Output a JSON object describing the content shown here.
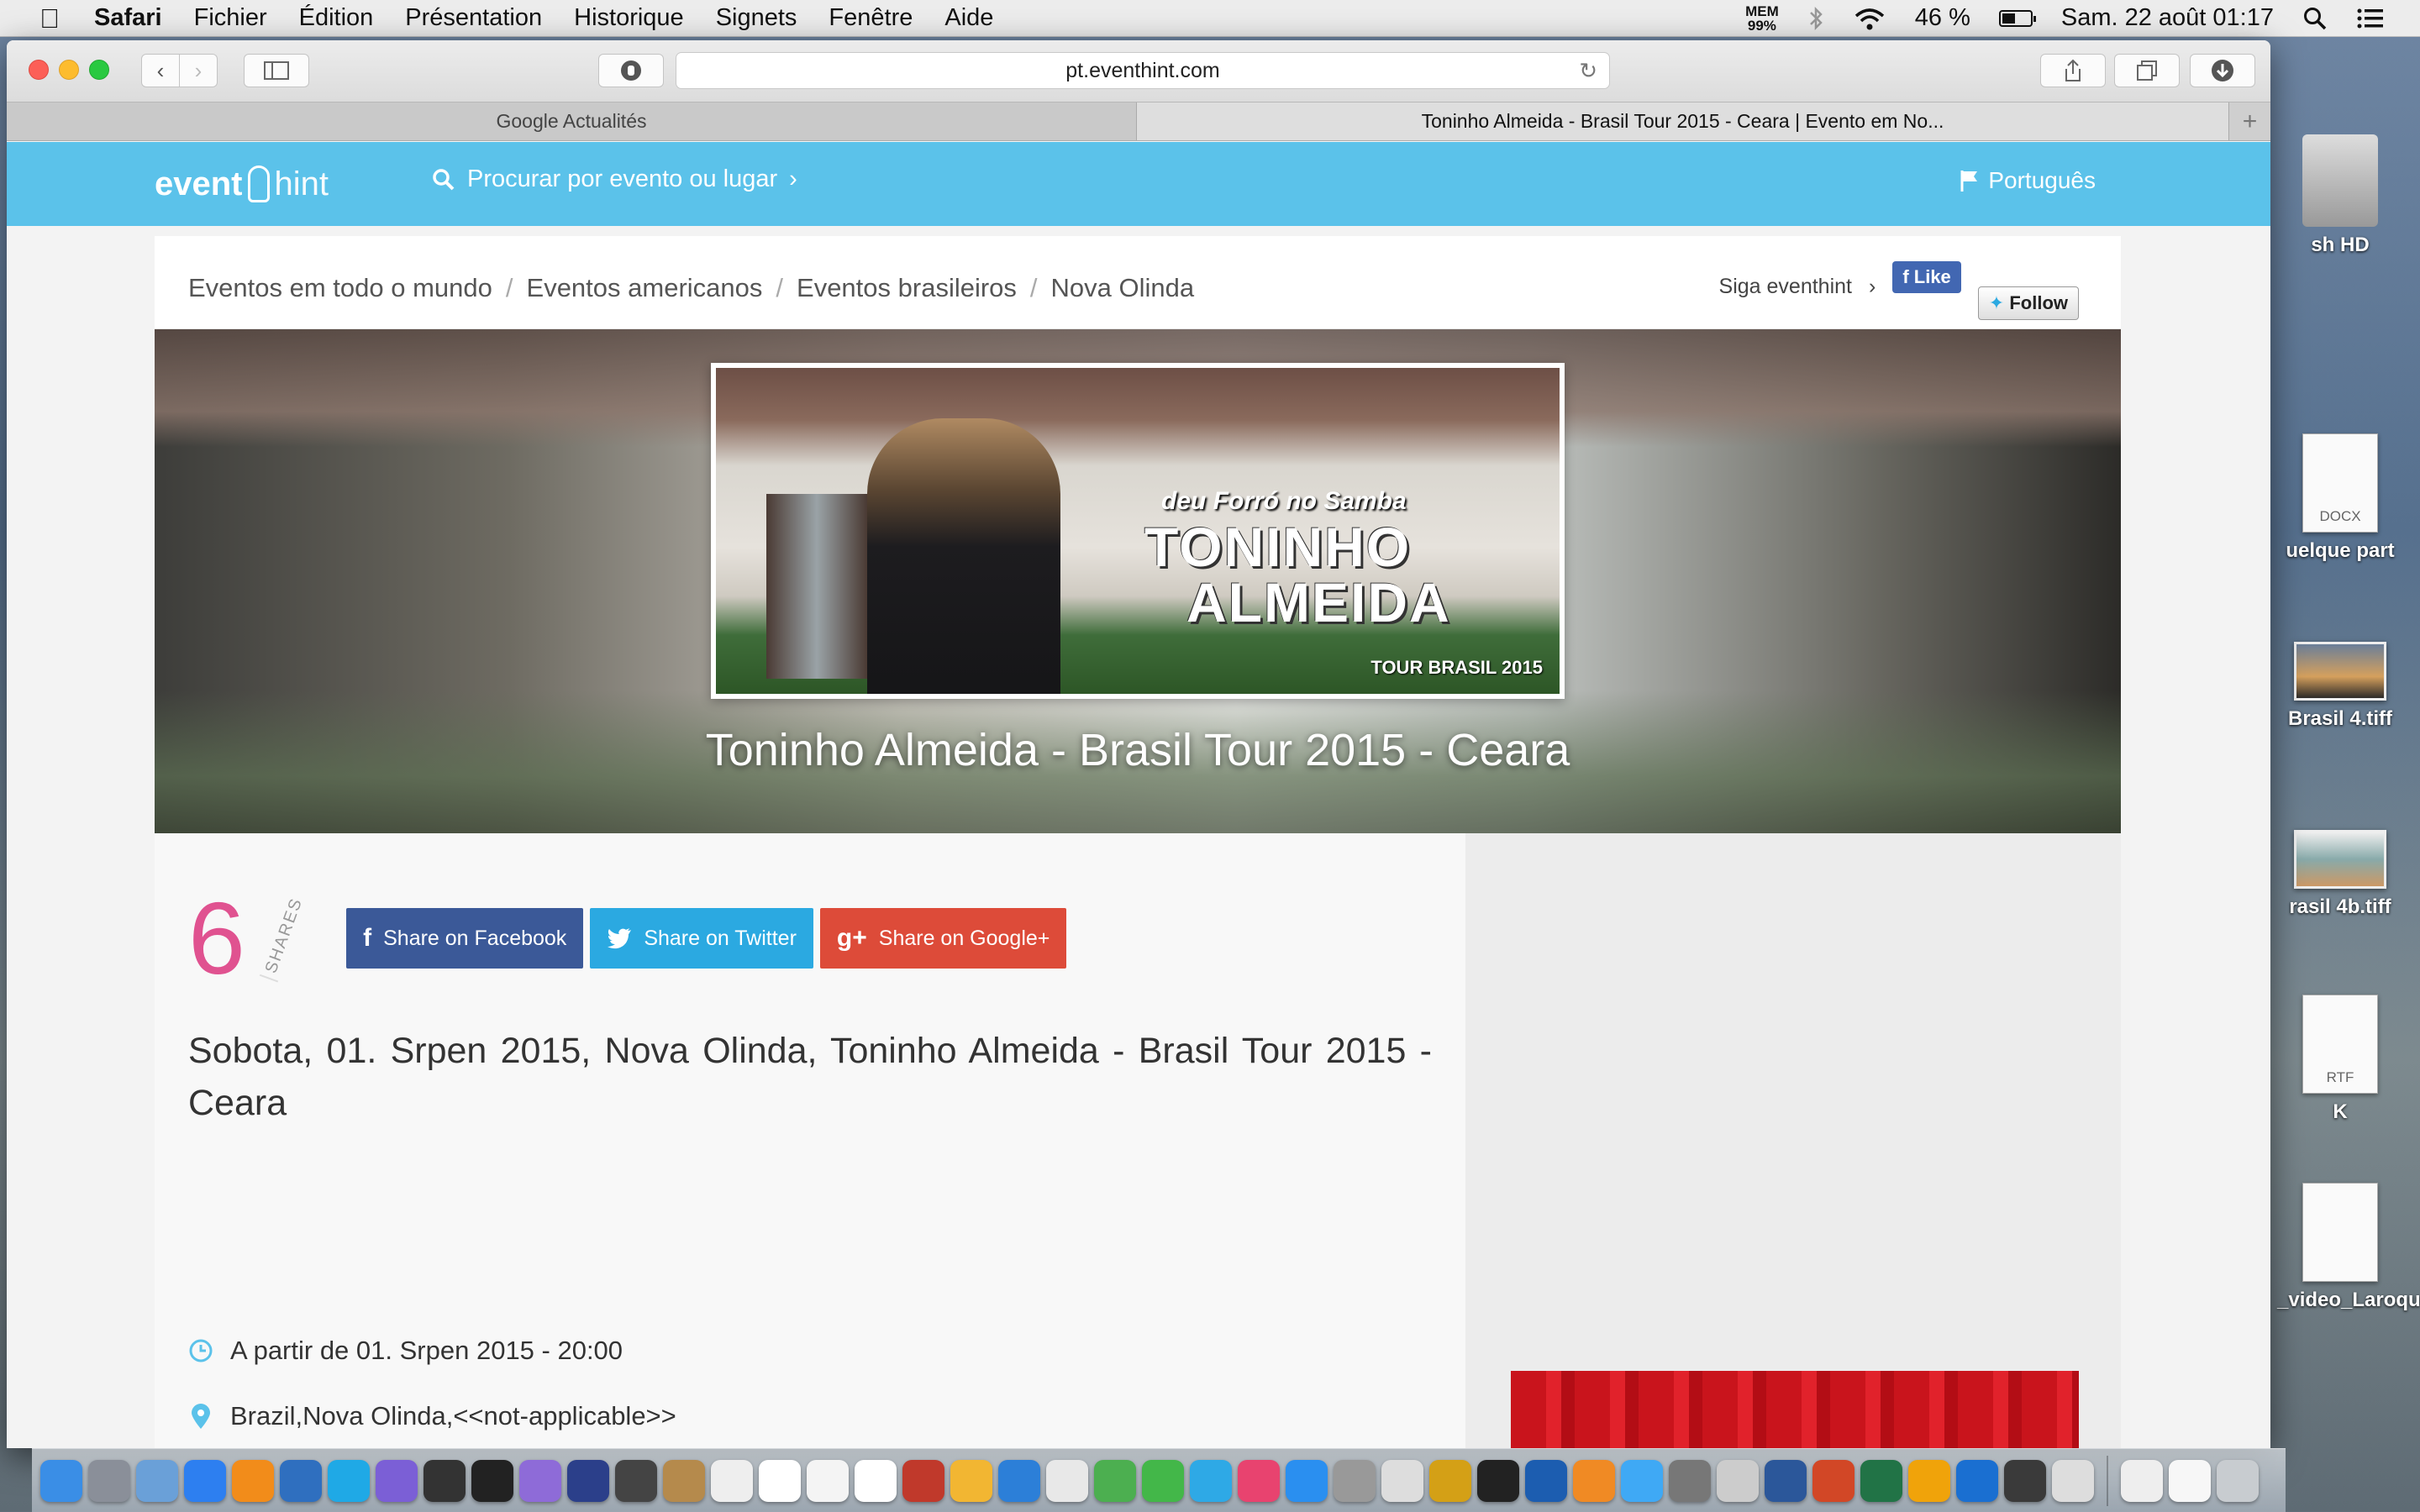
{
  "menubar": {
    "app": "Safari",
    "items": [
      "Fichier",
      "Édition",
      "Présentation",
      "Historique",
      "Signets",
      "Fenêtre",
      "Aide"
    ],
    "mem_label": "MEM",
    "mem_value": "99%",
    "battery": "46 %",
    "battery_level": 0.46,
    "datetime": "Sam. 22 août 01:17"
  },
  "desktop": {
    "items": [
      {
        "label": "sh HD"
      },
      {
        "label": "uelque part",
        "tag": "DOCX"
      },
      {
        "label": "Brasil 4.tiff"
      },
      {
        "label": "rasil 4b.tiff"
      },
      {
        "label": "K",
        "tag": "RTF"
      },
      {
        "label": "_video_Laroque"
      }
    ]
  },
  "safari": {
    "url": "pt.eventhint.com",
    "tabs": [
      "Google Actualités",
      "Toninho Almeida - Brasil Tour 2015 - Ceara | Evento em No..."
    ]
  },
  "site": {
    "logo_bold": "event",
    "logo_light": "hint",
    "search_text": "Procurar por evento ou lugar",
    "language": "Português",
    "breadcrumb": [
      "Eventos em todo o mundo",
      "Eventos americanos",
      "Eventos brasileiros",
      "Nova Olinda"
    ],
    "follow_text": "Siga eventhint",
    "fb_like": "Like",
    "tw_follow": "Follow"
  },
  "hero": {
    "poster_sub": "deu Forró no Samba",
    "poster_title_1": "TONINHO",
    "poster_title_2": "ALMEIDA",
    "poster_tour": "TOUR BRASIL 2015",
    "title": "Toninho Almeida - Brasil Tour 2015 - Ceara"
  },
  "shares": {
    "count": "6",
    "label": "SHARES",
    "facebook": "Share on Facebook",
    "twitter": "Share on Twitter",
    "google": "Share on Google+"
  },
  "event": {
    "headline": "Sobota, 01. Srpen 2015, Nova Olinda, Toninho Almeida - Brasil Tour 2015 - Ceara",
    "time": "A partir de 01. Srpen 2015 - 20:00",
    "location": "Brazil,Nova Olinda,<<not-applicable>>"
  },
  "colors": {
    "accent": "#5bc2ea",
    "shares_count": "#e05290",
    "facebook": "#3b5998",
    "twitter": "#2ba9e1",
    "google": "#dd4b39"
  },
  "dock": {
    "icons": [
      "finder-icon",
      "launchpad-icon",
      "preview-icon",
      "safari-icon",
      "vlc-icon",
      "quicktime-icon",
      "skype-icon",
      "imovie-icon",
      "finalcut-icon",
      "procut-icon",
      "imovie-star-icon",
      "dvd-icon",
      "photo-icon",
      "contacts-icon",
      "calendar-icon",
      "notes-icon",
      "textedit-icon",
      "reminders-icon",
      "photo-booth-icon",
      "photos-icon",
      "keynote-icon",
      "pages-icon",
      "numbers-icon",
      "facetime-icon",
      "messages-icon",
      "itunes-icon",
      "appstore-icon",
      "toolkit-icon",
      "pencil-icon",
      "drive-icon",
      "shazam-icon",
      "dashboard-icon",
      "books-icon",
      "weather-icon",
      "system-prefs-icon",
      "archive-icon",
      "word-icon",
      "powerpoint-icon",
      "excel-icon",
      "outlook-icon",
      "ccleaner-icon",
      "spotify-icon",
      "keyboard-icon",
      "downloads-stack-icon",
      "document-stack-icon",
      "trash-icon"
    ]
  }
}
